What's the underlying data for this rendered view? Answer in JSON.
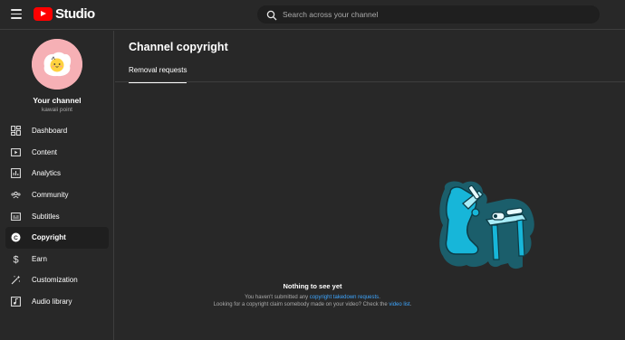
{
  "header": {
    "app_name": "Studio",
    "search_placeholder": "Search across your channel"
  },
  "channel": {
    "title": "Your channel",
    "name": "kawaii point"
  },
  "sidebar": {
    "items": [
      {
        "label": "Dashboard",
        "icon": "dashboard-icon"
      },
      {
        "label": "Content",
        "icon": "content-icon"
      },
      {
        "label": "Analytics",
        "icon": "analytics-icon"
      },
      {
        "label": "Community",
        "icon": "community-icon"
      },
      {
        "label": "Subtitles",
        "icon": "subtitles-icon"
      },
      {
        "label": "Copyright",
        "icon": "copyright-icon",
        "active": true
      },
      {
        "label": "Earn",
        "icon": "dollar-icon"
      },
      {
        "label": "Customization",
        "icon": "magic-wand-icon"
      },
      {
        "label": "Audio library",
        "icon": "audio-library-icon"
      }
    ]
  },
  "main": {
    "title": "Channel copyright",
    "tabs": [
      {
        "label": "Removal requests",
        "selected": true
      }
    ],
    "empty_state": {
      "title": "Nothing to see yet",
      "line1_prefix": "You haven't submitted any",
      "line1_link": "copyright takedown requests",
      "line1_suffix": ".",
      "line2_prefix": "Looking for a copyright claim somebody made on your video? Check the",
      "line2_link": "video list",
      "line2_suffix": "."
    }
  },
  "colors": {
    "background": "#282828",
    "accent_link": "#3ea6ff",
    "brand_red": "#ff0000",
    "illustration_cyan": "#17b6d9"
  }
}
